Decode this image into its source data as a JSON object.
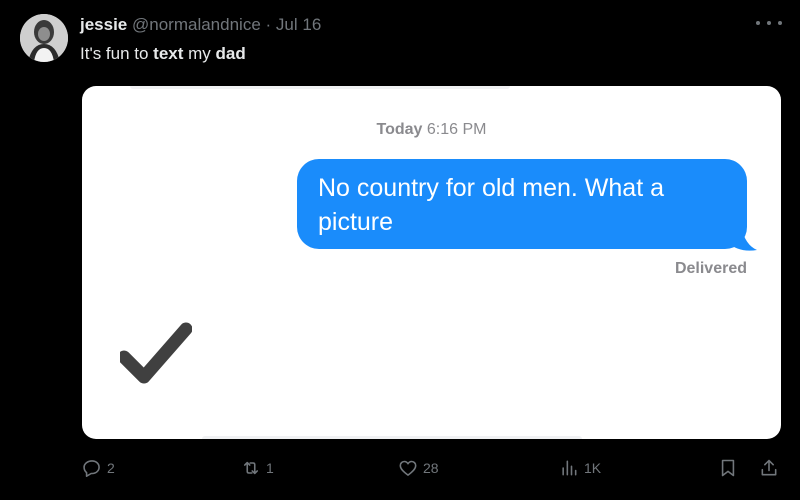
{
  "tweet": {
    "author_name": "jessie",
    "handle": "@normalandnice",
    "separator": "·",
    "date": "Jul 16",
    "text_parts": [
      "It's fun to ",
      "text",
      " my ",
      "dad"
    ]
  },
  "media": {
    "timestamp_day": "Today",
    "timestamp_time": "6:16 PM",
    "message": "No country for old men. What a picture",
    "status": "Delivered"
  },
  "actions": {
    "reply_count": "2",
    "retweet_count": "1",
    "like_count": "28",
    "views_count": "1K"
  },
  "colors": {
    "background": "#000000",
    "imessage_blue": "#1a8cfb",
    "muted_text": "#71767b"
  }
}
